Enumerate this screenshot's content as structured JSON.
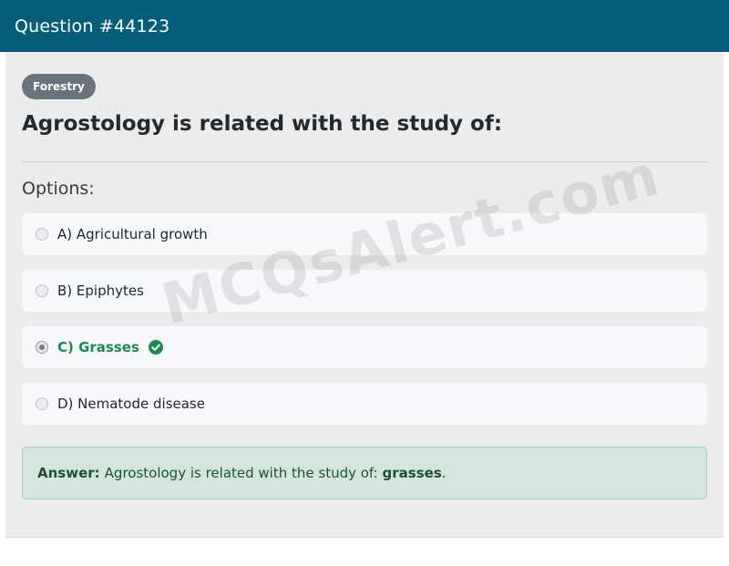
{
  "header": {
    "title": "Question #44123"
  },
  "category_tag": "Forestry",
  "question": "Agrostology is related with the study of:",
  "options_label": "Options:",
  "options": [
    {
      "label": "A) Agricultural growth",
      "selected": false,
      "correct": false
    },
    {
      "label": "B) Epiphytes",
      "selected": false,
      "correct": false
    },
    {
      "label": "C) Grasses",
      "selected": true,
      "correct": true
    },
    {
      "label": "D) Nematode disease",
      "selected": false,
      "correct": false
    }
  ],
  "answer": {
    "label": "Answer:",
    "text": "Agrostology is related with the study of:",
    "highlight": "grasses",
    "suffix": "."
  },
  "watermark": "MCQsAlert.com",
  "colors": {
    "header": "#065f7a",
    "correct": "#1b8a52",
    "answer_bg": "#d2e6de"
  },
  "icons": {
    "correct": "check-circle-icon",
    "radio": "radio-icon"
  }
}
